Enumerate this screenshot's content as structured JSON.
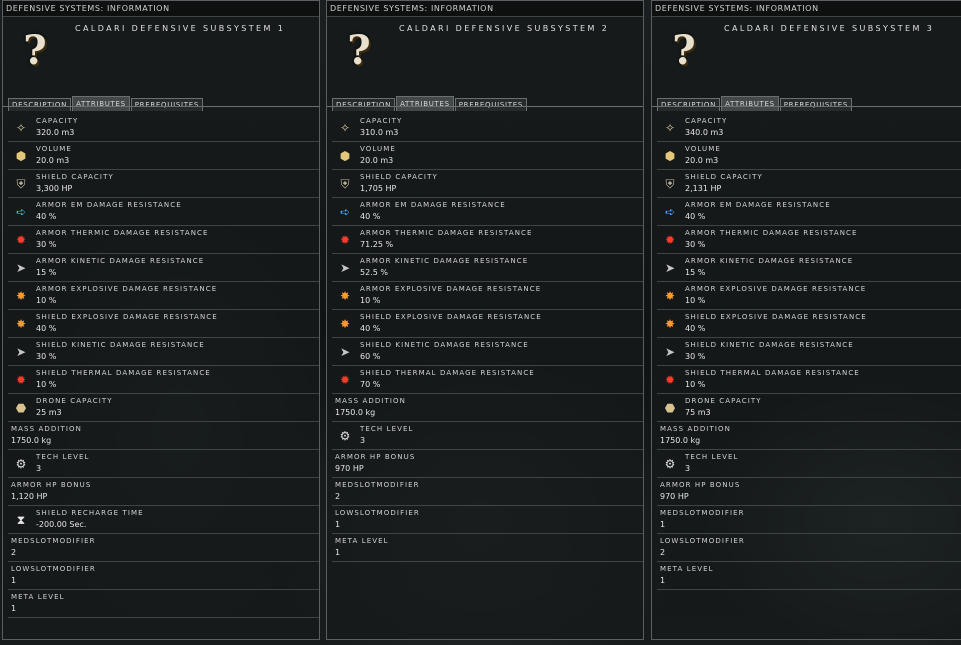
{
  "panels": [
    {
      "window_title": "DEFENSIVE SYSTEMS: INFORMATION",
      "item_name": "CALDARI DEFENSIVE SUBSYSTEM 1",
      "tabs": [
        "DESCRIPTION",
        "ATTRIBUTES",
        "PREREQUISITES"
      ],
      "active_tab": "ATTRIBUTES",
      "attributes": [
        {
          "icon": "capacity-icon",
          "label": "CAPACITY",
          "value": "320.0 m3"
        },
        {
          "icon": "volume-icon",
          "label": "VOLUME",
          "value": "20.0 m3"
        },
        {
          "icon": "shield-icon",
          "label": "SHIELD CAPACITY",
          "value": "3,300 HP"
        },
        {
          "icon": "em-resistance-icon",
          "label": "ARMOR EM DAMAGE RESISTANCE",
          "value": "40 %"
        },
        {
          "icon": "thermal-resistance-icon",
          "label": "ARMOR THERMIC DAMAGE RESISTANCE",
          "value": "30 %"
        },
        {
          "icon": "kinetic-resistance-icon",
          "label": "ARMOR KINETIC DAMAGE RESISTANCE",
          "value": "15 %"
        },
        {
          "icon": "explosive-resistance-icon",
          "label": "ARMOR EXPLOSIVE DAMAGE RESISTANCE",
          "value": "10 %"
        },
        {
          "icon": "explosive-resistance-icon",
          "label": "SHIELD EXPLOSIVE DAMAGE RESISTANCE",
          "value": "40 %"
        },
        {
          "icon": "kinetic-resistance-icon",
          "label": "SHIELD KINETIC DAMAGE RESISTANCE",
          "value": "30 %"
        },
        {
          "icon": "thermal-resistance-icon",
          "label": "SHIELD THERMAL DAMAGE RESISTANCE",
          "value": "10 %"
        },
        {
          "icon": "drone-icon",
          "label": "DRONE CAPACITY",
          "value": "25 m3"
        },
        {
          "icon": "",
          "label": "MASS ADDITION",
          "value": "1750.0 kg"
        },
        {
          "icon": "tech-level-icon",
          "label": "TECH LEVEL",
          "value": "3"
        },
        {
          "icon": "",
          "label": "ARMOR HP BONUS",
          "value": "1,120 HP"
        },
        {
          "icon": "hourglass-icon",
          "label": "SHIELD RECHARGE TIME",
          "value": "-200.00 Sec."
        },
        {
          "icon": "",
          "label": "MEDSLOTMODIFIER",
          "value": "2"
        },
        {
          "icon": "",
          "label": "LOWSLOTMODIFIER",
          "value": "1"
        },
        {
          "icon": "",
          "label": "META LEVEL",
          "value": "1"
        }
      ]
    },
    {
      "window_title": "DEFENSIVE SYSTEMS: INFORMATION",
      "item_name": "CALDARI DEFENSIVE SUBSYSTEM 2",
      "tabs": [
        "DESCRIPTION",
        "ATTRIBUTES",
        "PREREQUISITES"
      ],
      "active_tab": "ATTRIBUTES",
      "attributes": [
        {
          "icon": "capacity-icon",
          "label": "CAPACITY",
          "value": "310.0 m3"
        },
        {
          "icon": "volume-icon",
          "label": "VOLUME",
          "value": "20.0 m3"
        },
        {
          "icon": "shield-icon",
          "label": "SHIELD CAPACITY",
          "value": "1,705 HP"
        },
        {
          "icon": "em-resistance-icon",
          "label": "ARMOR EM DAMAGE RESISTANCE",
          "value": "40 %"
        },
        {
          "icon": "thermal-resistance-icon",
          "label": "ARMOR THERMIC DAMAGE RESISTANCE",
          "value": "71.25 %"
        },
        {
          "icon": "kinetic-resistance-icon",
          "label": "ARMOR KINETIC DAMAGE RESISTANCE",
          "value": "52.5 %"
        },
        {
          "icon": "explosive-resistance-icon",
          "label": "ARMOR EXPLOSIVE DAMAGE RESISTANCE",
          "value": "10 %"
        },
        {
          "icon": "explosive-resistance-icon",
          "label": "SHIELD EXPLOSIVE DAMAGE RESISTANCE",
          "value": "40 %"
        },
        {
          "icon": "kinetic-resistance-icon",
          "label": "SHIELD KINETIC DAMAGE RESISTANCE",
          "value": "60 %"
        },
        {
          "icon": "thermal-resistance-icon",
          "label": "SHIELD THERMAL DAMAGE RESISTANCE",
          "value": "70 %"
        },
        {
          "icon": "",
          "label": "MASS ADDITION",
          "value": "1750.0 kg"
        },
        {
          "icon": "tech-level-icon",
          "label": "TECH LEVEL",
          "value": "3"
        },
        {
          "icon": "",
          "label": "ARMOR HP BONUS",
          "value": "970 HP"
        },
        {
          "icon": "",
          "label": "MEDSLOTMODIFIER",
          "value": "2"
        },
        {
          "icon": "",
          "label": "LOWSLOTMODIFIER",
          "value": "1"
        },
        {
          "icon": "",
          "label": "META LEVEL",
          "value": "1"
        }
      ]
    },
    {
      "window_title": "DEFENSIVE SYSTEMS: INFORMATION",
      "item_name": "CALDARI DEFENSIVE SUBSYSTEM 3",
      "tabs": [
        "DESCRIPTION",
        "ATTRIBUTES",
        "PREREQUISITES"
      ],
      "active_tab": "ATTRIBUTES",
      "attributes": [
        {
          "icon": "capacity-icon",
          "label": "CAPACITY",
          "value": "340.0 m3"
        },
        {
          "icon": "volume-icon",
          "label": "VOLUME",
          "value": "20.0 m3"
        },
        {
          "icon": "shield-icon",
          "label": "SHIELD CAPACITY",
          "value": "2,131 HP"
        },
        {
          "icon": "em-resistance-icon",
          "label": "ARMOR EM DAMAGE RESISTANCE",
          "value": "40 %"
        },
        {
          "icon": "thermal-resistance-icon",
          "label": "ARMOR THERMIC DAMAGE RESISTANCE",
          "value": "30 %"
        },
        {
          "icon": "kinetic-resistance-icon",
          "label": "ARMOR KINETIC DAMAGE RESISTANCE",
          "value": "15 %"
        },
        {
          "icon": "explosive-resistance-icon",
          "label": "ARMOR EXPLOSIVE DAMAGE RESISTANCE",
          "value": "10 %"
        },
        {
          "icon": "explosive-resistance-icon",
          "label": "SHIELD EXPLOSIVE DAMAGE RESISTANCE",
          "value": "40 %"
        },
        {
          "icon": "kinetic-resistance-icon",
          "label": "SHIELD KINETIC DAMAGE RESISTANCE",
          "value": "30 %"
        },
        {
          "icon": "thermal-resistance-icon",
          "label": "SHIELD THERMAL DAMAGE RESISTANCE",
          "value": "10 %"
        },
        {
          "icon": "drone-icon",
          "label": "DRONE CAPACITY",
          "value": "75 m3"
        },
        {
          "icon": "",
          "label": "MASS ADDITION",
          "value": "1750.0 kg"
        },
        {
          "icon": "tech-level-icon",
          "label": "TECH LEVEL",
          "value": "3"
        },
        {
          "icon": "",
          "label": "ARMOR HP BONUS",
          "value": "970 HP"
        },
        {
          "icon": "",
          "label": "MEDSLOTMODIFIER",
          "value": "1"
        },
        {
          "icon": "",
          "label": "LOWSLOTMODIFIER",
          "value": "2"
        },
        {
          "icon": "",
          "label": "META LEVEL",
          "value": "1"
        }
      ]
    }
  ]
}
